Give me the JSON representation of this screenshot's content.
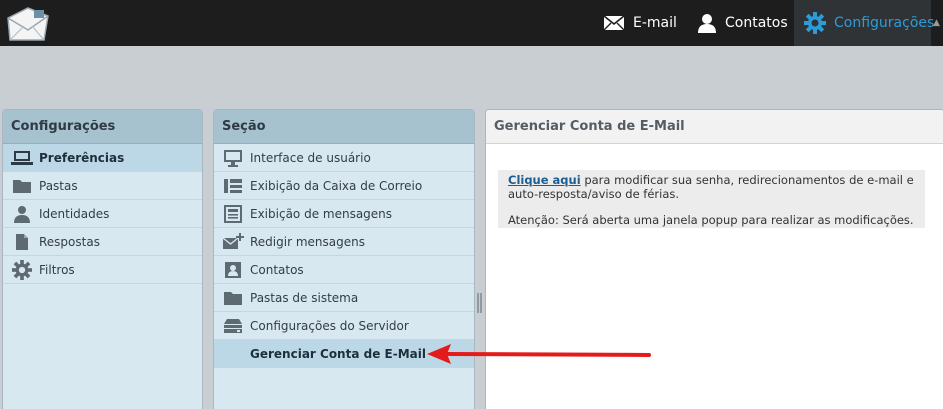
{
  "topbar": {
    "email_label": "E-mail",
    "contacts_label": "Contatos",
    "settings_label": "Configurações",
    "settings_color": "#2b9cd8"
  },
  "config_panel": {
    "title": "Configurações",
    "items": [
      {
        "label": "Preferências",
        "icon": "laptop-icon",
        "selected": true
      },
      {
        "label": "Pastas",
        "icon": "folder-icon"
      },
      {
        "label": "Identidades",
        "icon": "user-icon"
      },
      {
        "label": "Respostas",
        "icon": "document-icon"
      },
      {
        "label": "Filtros",
        "icon": "gear-icon"
      }
    ]
  },
  "section_panel": {
    "title": "Seção",
    "items": [
      {
        "label": "Interface de usuário",
        "icon": "monitor-icon"
      },
      {
        "label": "Exibição da Caixa de Correio",
        "icon": "list-layout-icon"
      },
      {
        "label": "Exibição de mensagens",
        "icon": "message-view-icon"
      },
      {
        "label": "Redigir mensagens",
        "icon": "compose-mail-icon"
      },
      {
        "label": "Contatos",
        "icon": "contact-card-icon"
      },
      {
        "label": "Pastas de sistema",
        "icon": "folder-icon"
      },
      {
        "label": "Configurações do Servidor",
        "icon": "server-icon"
      },
      {
        "label": "Gerenciar Conta de E-Mail",
        "icon": "",
        "selected": true
      }
    ]
  },
  "manage_panel": {
    "title": "Gerenciar Conta de E-Mail",
    "link_text": "Clique aqui",
    "description": " para modificar sua senha, redirecionamentos de e-mail e auto-resposta/aviso de férias.",
    "warning": "Atenção: Será aberta uma janela popup para realizar as modificações."
  },
  "annotation": {
    "arrow_color": "#e31b1b"
  }
}
